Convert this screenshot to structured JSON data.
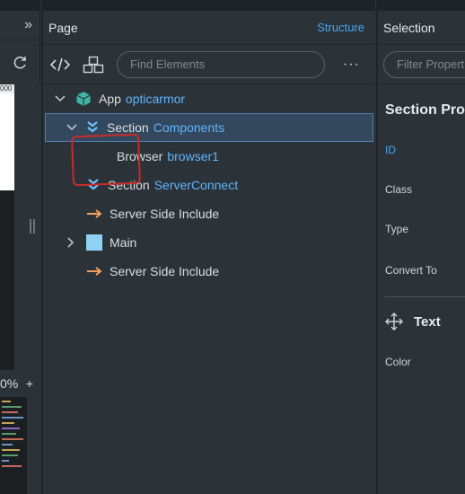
{
  "left": {
    "collapse_glyph": "»",
    "refresh_icon": "refresh-icon",
    "ruler_text": "000",
    "zoom_text": "0%",
    "zoom_plus": "+"
  },
  "page_panel": {
    "title": "Page",
    "structure_link": "Structure",
    "search_placeholder": "Find Elements",
    "more_label": "···",
    "tree": [
      {
        "keyword": "App",
        "name": "opticarmor"
      },
      {
        "keyword": "Section",
        "name": "Components"
      },
      {
        "keyword": "Browser",
        "name": "browser1"
      },
      {
        "keyword": "Section",
        "name": "ServerConnect"
      },
      {
        "keyword": "Server Side Include",
        "name": ""
      },
      {
        "keyword": "Main",
        "name": ""
      },
      {
        "keyword": "Server Side Include",
        "name": ""
      }
    ]
  },
  "selection_panel": {
    "title": "Selection",
    "filter_placeholder": "Filter Properties",
    "section_title": "Section Properties",
    "labels": [
      "ID",
      "Class",
      "Type",
      "Convert To"
    ],
    "text_group": "Text",
    "color_label": "Color"
  },
  "colors": {
    "accent": "#4aa3f0",
    "name_blue": "#5eb4ff",
    "selection_bg": "#34485d",
    "annotation_red": "#c92b2b",
    "arrow_orange": "#f0a060",
    "box_cyan": "#8fd3f4"
  }
}
